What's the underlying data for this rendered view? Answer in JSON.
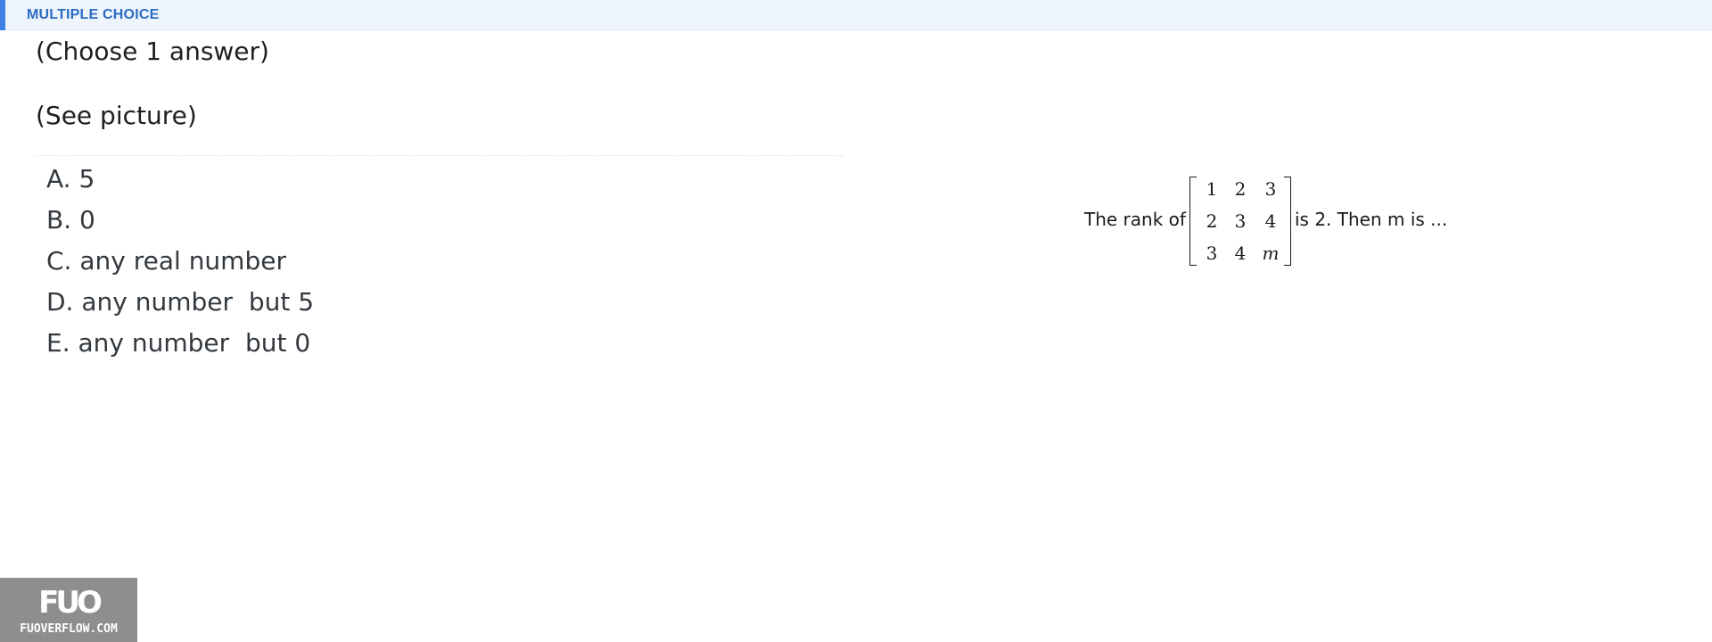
{
  "header": {
    "title": "MULTIPLE CHOICE"
  },
  "question": {
    "instruction": "(Choose 1 answer)",
    "picture_note": "(See picture)"
  },
  "answers": [
    {
      "label": "A. 5"
    },
    {
      "label": "B. 0"
    },
    {
      "label": "C. any real number"
    },
    {
      "label": "D. any number  but 5"
    },
    {
      "label": "E. any number  but 0"
    }
  ],
  "picture": {
    "prefix": "The rank of",
    "suffix": "is 2. Then m is ...",
    "matrix": [
      [
        "1",
        "2",
        "3"
      ],
      [
        "2",
        "3",
        "4"
      ],
      [
        "3",
        "4",
        "m"
      ]
    ]
  },
  "watermark": {
    "logo": "FUO",
    "domain": "FUOVERFLOW.COM"
  },
  "colors": {
    "accent": "#3c82e6",
    "header_bg": "#eef4fc",
    "header_text": "#2b6cc4",
    "answer_text": "#33393e",
    "watermark_bg": "#8e8e8e"
  }
}
